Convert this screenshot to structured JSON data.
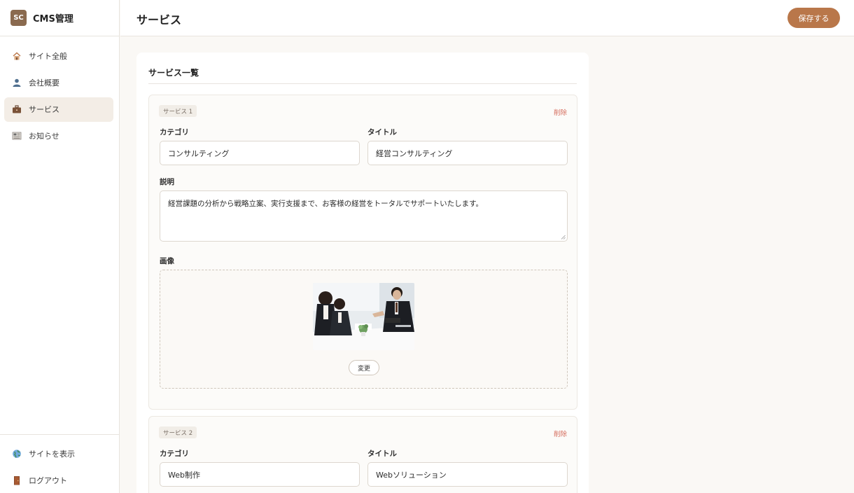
{
  "brand": {
    "logo_text": "SC",
    "name": "CMS管理"
  },
  "sidebar": {
    "items": [
      {
        "label": "サイト全般",
        "icon": "house-icon"
      },
      {
        "label": "会社概要",
        "icon": "person-icon"
      },
      {
        "label": "サービス",
        "icon": "briefcase-icon",
        "active": true
      },
      {
        "label": "お知らせ",
        "icon": "newspaper-icon"
      }
    ],
    "bottom": [
      {
        "label": "サイトを表示",
        "icon": "globe-icon"
      },
      {
        "label": "ログアウト",
        "icon": "door-icon"
      }
    ]
  },
  "header": {
    "title": "サービス",
    "save_label": "保存する"
  },
  "panel": {
    "title": "サービス一覧",
    "services": [
      {
        "badge": "サービス 1",
        "delete_label": "削除",
        "category_label": "カテゴリ",
        "category_value": "コンサルティング",
        "title_label": "タイトル",
        "title_value": "経営コンサルティング",
        "description_label": "説明",
        "description_value": "経営課題の分析から戦略立案、実行支援まで、お客様の経営をトータルでサポートいたします。",
        "image_label": "画像",
        "change_label": "変更"
      },
      {
        "badge": "サービス 2",
        "delete_label": "削除",
        "category_label": "カテゴリ",
        "category_value": "Web制作",
        "title_label": "タイトル",
        "title_value": "Webソリューション"
      }
    ]
  },
  "colors": {
    "accent": "#b9774a",
    "danger": "#d46a5a",
    "active_bg": "#f3ede6",
    "background": "#faf8f5"
  }
}
